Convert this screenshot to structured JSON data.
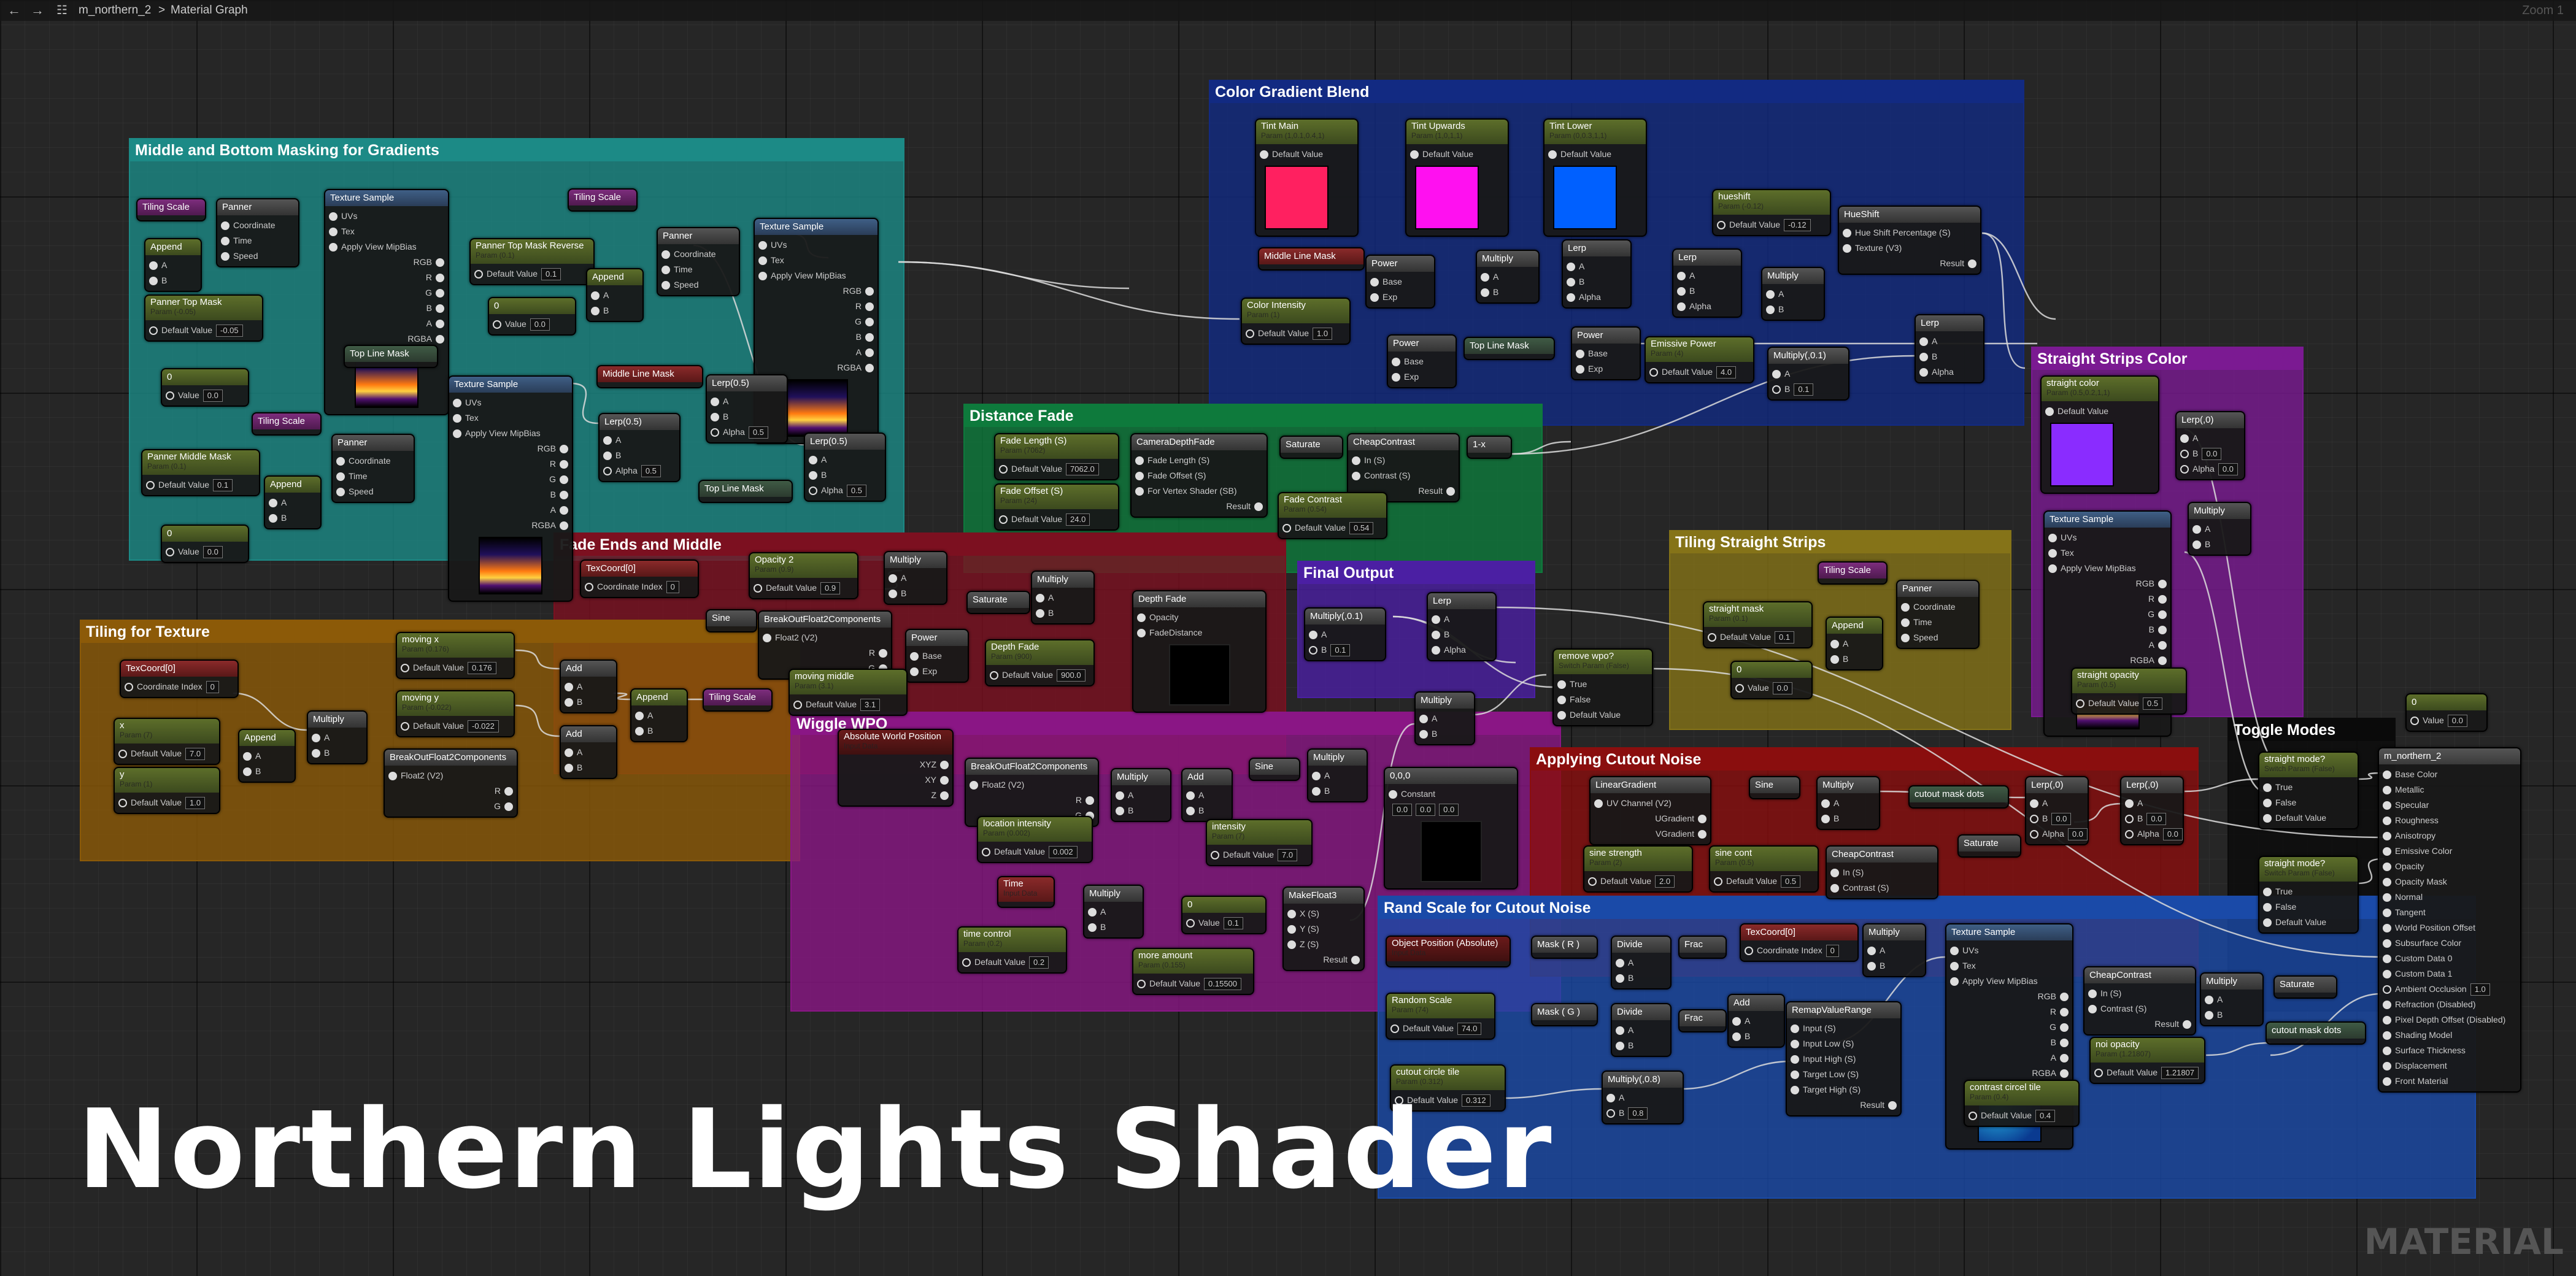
{
  "window": {
    "asset_name": "m_northern_2",
    "breadcrumb": "Material Graph",
    "zoom": "Zoom 1"
  },
  "icons": {
    "back": "arrow-left-icon",
    "forward": "arrow-right-icon",
    "graph": "graph-icon"
  },
  "title": "Northern Lights Shader",
  "watermark": "MATERIAL",
  "colors": {
    "teal": "#1c8a86",
    "blue": "#122a82",
    "green": "#0e7a3c",
    "crimson": "#7c1020",
    "orange": "#8c5a08",
    "purple": "#4b1fa3",
    "olive": "#857318",
    "magenta": "#8a1685",
    "violet": "#7b1a92",
    "red": "#8a0e0e",
    "rand_blue": "#1a4aa8",
    "black": "#0a0a0a",
    "swatch_red": "#ff2060",
    "swatch_magenta": "#ff10f0",
    "swatch_blue": "#0060ff",
    "swatch_violet": "#8a2cff"
  },
  "comments": [
    {
      "title": "Middle and Bottom Masking for Gradients"
    },
    {
      "title": "Color Gradient Blend"
    },
    {
      "title": "Distance Fade"
    },
    {
      "title": "Fade Ends and Middle"
    },
    {
      "title": "Tiling for Texture"
    },
    {
      "title": "Final Output"
    },
    {
      "title": "Tiling Straight Strips"
    },
    {
      "title": "Straight Strips Color"
    },
    {
      "title": "Wiggle WPO"
    },
    {
      "title": "Applying Cutout Noise"
    },
    {
      "title": "Toggle Modes"
    },
    {
      "title": "Rand Scale for Cutout Noise"
    }
  ],
  "nodes": {
    "tiling_scale_a": {
      "title": "Tiling Scale"
    },
    "panner_a": {
      "title": "Panner",
      "rows": [
        "Coordinate",
        "Time",
        "Speed"
      ]
    },
    "append_a": {
      "title": "Append",
      "rows": [
        "A",
        "B"
      ]
    },
    "panner_top_mask": {
      "title": "Panner Top Mask",
      "sub": "Param (-0.05)",
      "rows": [
        "Default Value"
      ],
      "val": "-0.05"
    },
    "texsample_a": {
      "title": "Texture Sample",
      "rows": [
        "UVs",
        "Tex",
        "Apply View MipBias"
      ],
      "outs": [
        "RGB",
        "R",
        "G",
        "B",
        "A",
        "RGBA"
      ]
    },
    "panner_top_mask_rev": {
      "title": "Panner Top Mask Reverse",
      "sub": "Param (0.1)",
      "rows": [
        "Default Value"
      ],
      "val": "0.1"
    },
    "append_b": {
      "title": "Append",
      "rows": [
        "A",
        "B"
      ]
    },
    "zero_a": {
      "title": "0",
      "rows": [
        "Value"
      ],
      "val": "0.0"
    },
    "tiling_scale_b": {
      "title": "Tiling Scale"
    },
    "panner_b": {
      "title": "Panner",
      "rows": [
        "Coordinate",
        "Time",
        "Speed"
      ]
    },
    "texsample_b": {
      "title": "Texture Sample",
      "rows": [
        "UVs",
        "Tex",
        "Apply View MipBias"
      ],
      "outs": [
        "RGB",
        "R",
        "G",
        "B",
        "A",
        "RGBA"
      ]
    },
    "top_line_mask_a": {
      "title": "Top Line Mask"
    },
    "zero_b": {
      "title": "0",
      "rows": [
        "Value"
      ],
      "val": "0.0"
    },
    "tiling_scale_c": {
      "title": "Tiling Scale"
    },
    "panner_c": {
      "title": "Panner",
      "rows": [
        "Coordinate",
        "Time",
        "Speed"
      ]
    },
    "panner_middle_mask": {
      "title": "Panner Middle Mask",
      "sub": "Param (0.1)",
      "rows": [
        "Default Value"
      ],
      "val": "0.1"
    },
    "append_c": {
      "title": "Append",
      "rows": [
        "A",
        "B"
      ]
    },
    "zero_c": {
      "title": "0",
      "rows": [
        "Value"
      ],
      "val": "0.0"
    },
    "texsample_c": {
      "title": "Texture Sample",
      "rows": [
        "UVs",
        "Tex",
        "Apply View MipBias"
      ],
      "outs": [
        "RGB",
        "R",
        "G",
        "B",
        "A",
        "RGBA"
      ]
    },
    "middle_line_mask_a": {
      "title": "Middle Line Mask"
    },
    "lerp_a": {
      "title": "Lerp(0.5)",
      "rows": [
        "A",
        "B",
        "Alpha"
      ],
      "val": "0.5"
    },
    "lerp_b": {
      "title": "Lerp(0.5)",
      "rows": [
        "A",
        "B",
        "Alpha"
      ],
      "val": "0.5"
    },
    "lerp_c": {
      "title": "Lerp(0.5)",
      "rows": [
        "A",
        "B",
        "Alpha"
      ],
      "val": "0.5"
    },
    "top_line_mask_b": {
      "title": "Top Line Mask"
    },
    "tint_main": {
      "title": "Tint Main",
      "sub": "Param (1,0.1,0.4,1)",
      "rows": [
        "Default Value"
      ]
    },
    "tint_upwards": {
      "title": "Tint Upwards",
      "sub": "Param (1,0,1,1)",
      "rows": [
        "Default Value"
      ]
    },
    "tint_lower": {
      "title": "Tint Lower",
      "sub": "Param (0,0.3,1,1)",
      "rows": [
        "Default Value"
      ]
    },
    "hueshift": {
      "title": "hueshift",
      "sub": "Param (-0.12)",
      "rows": [
        "Default Value"
      ],
      "val": "-0.12"
    },
    "hueshift_fn": {
      "title": "HueShift",
      "rows": [
        "Hue Shift Percentage (S)",
        "Texture (V3)"
      ],
      "outs": [
        "Result"
      ]
    },
    "middle_line_mask_b": {
      "title": "Middle Line Mask"
    },
    "power_a": {
      "title": "Power",
      "rows": [
        "Base",
        "Exp"
      ]
    },
    "color_intensity": {
      "title": "Color Intensity",
      "sub": "Param (1)",
      "rows": [
        "Default Value"
      ],
      "val": "1.0"
    },
    "multiply_a": {
      "title": "Multiply",
      "rows": [
        "A",
        "B"
      ]
    },
    "lerp_d": {
      "title": "Lerp",
      "rows": [
        "A",
        "B",
        "Alpha"
      ]
    },
    "lerp_e": {
      "title": "Lerp",
      "rows": [
        "A",
        "B",
        "Alpha"
      ]
    },
    "multiply_b": {
      "title": "Multiply",
      "rows": [
        "A",
        "B"
      ]
    },
    "power_b": {
      "title": "Power",
      "rows": [
        "Base",
        "Exp"
      ]
    },
    "top_line_mask_c": {
      "title": "Top Line Mask"
    },
    "power_c": {
      "title": "Power",
      "rows": [
        "Base",
        "Exp"
      ]
    },
    "emissive_power": {
      "title": "Emissive Power",
      "sub": "Param (4)",
      "rows": [
        "Default Value"
      ],
      "val": "4.0"
    },
    "multiply_c": {
      "title": "Multiply(,0.1)",
      "rows": [
        "A",
        "B"
      ],
      "val": "0.1"
    },
    "lerp_f": {
      "title": "Lerp",
      "rows": [
        "A",
        "B",
        "Alpha"
      ]
    },
    "fade_length": {
      "title": "Fade Length (S)",
      "sub": "Param (7062)",
      "rows": [
        "Default Value"
      ],
      "val": "7062.0"
    },
    "camera_depth_fade": {
      "title": "CameraDepthFade",
      "rows": [
        "Fade Length (S)",
        "Fade Offset (S)",
        "For Vertex Shader (SB)"
      ],
      "outs": [
        "Result"
      ]
    },
    "saturate_a": {
      "title": "Saturate"
    },
    "cheap_contrast_a": {
      "title": "CheapContrast",
      "rows": [
        "In (S)",
        "Contrast (S)"
      ],
      "outs": [
        "Result"
      ]
    },
    "one_minus_a": {
      "title": "1-x"
    },
    "fade_offset": {
      "title": "Fade Offset (S)",
      "sub": "Param (24)",
      "rows": [
        "Default Value"
      ],
      "val": "24.0"
    },
    "fade_contrast": {
      "title": "Fade Contrast",
      "sub": "Param (0.54)",
      "rows": [
        "Default Value"
      ],
      "val": "0.54"
    },
    "texcoord_a": {
      "title": "TexCoord[0]",
      "rows": [
        "Coordinate Index"
      ],
      "val": "0"
    },
    "opacity2": {
      "title": "Opacity 2",
      "sub": "Param (0.9)",
      "rows": [
        "Default Value"
      ],
      "val": "0.9"
    },
    "multiply_d": {
      "title": "Multiply",
      "rows": [
        "A",
        "B"
      ]
    },
    "sine_a": {
      "title": "Sine"
    },
    "breakout_a": {
      "title": "BreakOutFloat2Components",
      "rows": [
        "Float2 (V2)"
      ],
      "outs": [
        "R",
        "G"
      ]
    },
    "power_d": {
      "title": "Power",
      "rows": [
        "Base",
        "Exp"
      ]
    },
    "saturate_b": {
      "title": "Saturate"
    },
    "multiply_e": {
      "title": "Multiply",
      "rows": [
        "A",
        "B"
      ]
    },
    "depth_fade": {
      "title": "Depth Fade",
      "rows": [
        "Opacity",
        "FadeDistance"
      ]
    },
    "depth_fade_param": {
      "title": "Depth Fade",
      "sub": "Param (900)",
      "rows": [
        "Default Value"
      ],
      "val": "900.0"
    },
    "moving_middle": {
      "title": "moving middle",
      "sub": "Param (3.1)",
      "rows": [
        "Default Value"
      ],
      "val": "3.1"
    },
    "multiply_final": {
      "title": "Multiply(,0.1)",
      "rows": [
        "A",
        "B"
      ],
      "val": "0.1"
    },
    "lerp_final": {
      "title": "Lerp",
      "rows": [
        "A",
        "B",
        "Alpha"
      ]
    },
    "texcoord_b": {
      "title": "TexCoord[0]",
      "rows": [
        "Coordinate Index"
      ],
      "val": "0"
    },
    "moving_x": {
      "title": "moving x",
      "sub": "Param (0.176)",
      "rows": [
        "Default Value"
      ],
      "val": "0.176"
    },
    "moving_y": {
      "title": "moving y",
      "sub": "Param (-0.022)",
      "rows": [
        "Default Value"
      ],
      "val": "-0.022"
    },
    "x_param": {
      "title": "x",
      "sub": "Param (7)",
      "rows": [
        "Default Value"
      ],
      "val": "7.0"
    },
    "y_param": {
      "title": "y",
      "sub": "Param (1)",
      "rows": [
        "Default Value"
      ],
      "val": "1.0"
    },
    "append_d": {
      "title": "Append",
      "rows": [
        "A",
        "B"
      ]
    },
    "multiply_f": {
      "title": "Multiply",
      "rows": [
        "A",
        "B"
      ]
    },
    "breakout_b": {
      "title": "BreakOutFloat2Components",
      "rows": [
        "Float2 (V2)"
      ],
      "outs": [
        "R",
        "G"
      ]
    },
    "add_a": {
      "title": "Add",
      "rows": [
        "A",
        "B"
      ]
    },
    "add_b": {
      "title": "Add",
      "rows": [
        "A",
        "B"
      ]
    },
    "append_e": {
      "title": "Append",
      "rows": [
        "A",
        "B"
      ]
    },
    "tiling_scale_d": {
      "title": "Tiling Scale"
    },
    "abs_world_pos": {
      "title": "Absolute World Position",
      "sub": "Input Data",
      "outs": [
        "XYZ",
        "XY",
        "Z"
      ]
    },
    "breakout_c": {
      "title": "BreakOutFloat2Components",
      "rows": [
        "Float2 (V2)"
      ],
      "outs": [
        "R",
        "G"
      ]
    },
    "location_intensity": {
      "title": "location intensity",
      "sub": "Param (0.002)",
      "rows": [
        "Default Value"
      ],
      "val": "0.002"
    },
    "multiply_g": {
      "title": "Multiply",
      "rows": [
        "A",
        "B"
      ]
    },
    "add_c": {
      "title": "Add",
      "rows": [
        "A",
        "B"
      ]
    },
    "sine_b": {
      "title": "Sine"
    },
    "intensity": {
      "title": "intensity",
      "sub": "Param (7)",
      "rows": [
        "Default Value"
      ],
      "val": "7.0"
    },
    "multiply_h": {
      "title": "Multiply",
      "rows": [
        "A",
        "B"
      ]
    },
    "time_a": {
      "title": "Time",
      "sub": "Input Data"
    },
    "multiply_i": {
      "title": "Multiply",
      "rows": [
        "A",
        "B"
      ]
    },
    "time_control": {
      "title": "time control",
      "sub": "Param (0.2)",
      "rows": [
        "Default Value"
      ],
      "val": "0.2"
    },
    "zero_d": {
      "title": "0",
      "rows": [
        "Value"
      ],
      "val": "0.1"
    },
    "make_float3": {
      "title": "MakeFloat3",
      "rows": [
        "X (S)",
        "Y (S)",
        "Z (S)"
      ],
      "outs": [
        "Result"
      ]
    },
    "more_amount": {
      "title": "more amount",
      "sub": "Param (0.155)",
      "rows": [
        "Default Value"
      ],
      "val": "0.15500"
    },
    "wpo_multiply": {
      "title": "Multiply",
      "rows": [
        "A",
        "B"
      ]
    },
    "constant3": {
      "title": "0,0,0",
      "rows": [
        "Constant"
      ],
      "vals": [
        "0.0",
        "0.0",
        "0.0"
      ]
    },
    "remove_wpo": {
      "title": "remove wpo?",
      "sub": "Switch Param (False)",
      "rows": [
        "True",
        "False",
        "Default Value"
      ]
    },
    "linear_gradient": {
      "title": "LinearGradient",
      "rows": [
        "UV Channel (V2)"
      ],
      "outs": [
        "UGradient",
        "VGradient"
      ]
    },
    "sine_c": {
      "title": "Sine"
    },
    "multiply_j": {
      "title": "Multiply",
      "rows": [
        "A",
        "B"
      ]
    },
    "cutout_mask_dots_a": {
      "title": "cutout mask dots"
    },
    "lerp_g": {
      "title": "Lerp(,0)",
      "rows": [
        "A",
        "B",
        "Alpha"
      ],
      "val": "0.0"
    },
    "lerp_h": {
      "title": "Lerp(,0)",
      "rows": [
        "A",
        "B",
        "Alpha"
      ],
      "val": "0.0"
    },
    "sine_strength": {
      "title": "sine strength",
      "sub": "Param (2)",
      "rows": [
        "Default Value"
      ],
      "val": "2.0"
    },
    "sine_cont": {
      "title": "sine cont",
      "sub": "Param (0.5)",
      "rows": [
        "Default Value"
      ],
      "val": "0.5"
    },
    "cheap_contrast_b": {
      "title": "CheapContrast",
      "rows": [
        "In (S)",
        "Contrast (S)"
      ]
    },
    "saturate_c": {
      "title": "Saturate"
    },
    "straight_mask": {
      "title": "straight mask",
      "sub": "Param (0.1)",
      "rows": [
        "Default Value"
      ],
      "val": "0.1"
    },
    "tiling_scale_e": {
      "title": "Tiling Scale"
    },
    "append_f": {
      "title": "Append",
      "rows": [
        "A",
        "B"
      ]
    },
    "panner_d": {
      "title": "Panner",
      "rows": [
        "Coordinate",
        "Time",
        "Speed"
      ]
    },
    "zero_e": {
      "title": "0",
      "rows": [
        "Value"
      ],
      "val": "0.0"
    },
    "straight_strips_color": {
      "title": "straight color",
      "sub": "Param (0.5,0.2,1,1)",
      "rows": [
        "Default Value"
      ]
    },
    "lerp_i": {
      "title": "Lerp(,0)",
      "rows": [
        "A",
        "B",
        "Alpha"
      ],
      "val": "0.0"
    },
    "multiply_k": {
      "title": "Multiply",
      "rows": [
        "A",
        "B"
      ]
    },
    "texsample_d": {
      "title": "Texture Sample",
      "rows": [
        "UVs",
        "Tex",
        "Apply View MipBias"
      ],
      "outs": [
        "RGB",
        "R",
        "G",
        "B",
        "A",
        "RGBA"
      ]
    },
    "straight_opacity": {
      "title": "straight opacity",
      "sub": "Param (0.5)",
      "rows": [
        "Default Value"
      ],
      "val": "0.5"
    },
    "zero_f": {
      "title": "0",
      "rows": [
        "Value"
      ],
      "val": "0.0"
    },
    "straight_mode_a": {
      "title": "straight mode?",
      "sub": "Switch Param (False)",
      "rows": [
        "True",
        "False",
        "Default Value"
      ]
    },
    "straight_mode_b": {
      "title": "straight mode?",
      "sub": "Switch Param (False)",
      "rows": [
        "True",
        "False",
        "Default Value"
      ]
    },
    "object_position": {
      "title": "Object Position (Absolute)",
      "sub": "Input Data"
    },
    "mask_rg_a": {
      "title": "Mask ( R )"
    },
    "divide_a": {
      "title": "Divide",
      "rows": [
        "A",
        "B"
      ]
    },
    "frac_a": {
      "title": "Frac"
    },
    "random_scale": {
      "title": "Random Scale",
      "sub": "Param (74)",
      "rows": [
        "Default Value"
      ],
      "val": "74.0"
    },
    "mask_g": {
      "title": "Mask ( G )"
    },
    "divide_b": {
      "title": "Divide",
      "rows": [
        "A",
        "B"
      ]
    },
    "frac_b": {
      "title": "Frac"
    },
    "add_d": {
      "title": "Add",
      "rows": [
        "A",
        "B"
      ]
    },
    "texcoord_c": {
      "title": "TexCoord[0]",
      "rows": [
        "Coordinate Index"
      ],
      "val": "0"
    },
    "multiply_l": {
      "title": "Multiply",
      "rows": [
        "A",
        "B"
      ]
    },
    "remap": {
      "title": "RemapValueRange",
      "rows": [
        "Input (S)",
        "Input Low (S)",
        "Input High (S)",
        "Target Low (S)",
        "Target High (S)"
      ],
      "outs": [
        "Result"
      ]
    },
    "texsample_e": {
      "title": "Texture Sample",
      "rows": [
        "UVs",
        "Tex",
        "Apply View MipBias"
      ],
      "outs": [
        "RGB",
        "R",
        "G",
        "B",
        "A",
        "RGBA"
      ]
    },
    "cheap_contrast_c": {
      "title": "CheapContrast",
      "rows": [
        "In (S)",
        "Contrast (S)"
      ],
      "outs": [
        "Result"
      ]
    },
    "multiply_m": {
      "title": "Multiply",
      "rows": [
        "A",
        "B"
      ]
    },
    "saturate_d": {
      "title": "Saturate"
    },
    "cutout_mask_dots_b": {
      "title": "cutout mask dots"
    },
    "noise_opacity": {
      "title": "noi opacity",
      "sub": "Param (1.21807)",
      "rows": [
        "Default Value"
      ],
      "val": "1.21807"
    },
    "cutout_circle_tile_a": {
      "title": "cutout circle tile",
      "sub": "Param (0.312)",
      "rows": [
        "Default Value"
      ],
      "val": "0.312"
    },
    "multiply_n": {
      "title": "Multiply(,0.8)",
      "rows": [
        "A",
        "B"
      ],
      "val": "0.8"
    },
    "contrast_circel_tile": {
      "title": "contrast circel tile",
      "sub": "Param (0.4)",
      "rows": [
        "Default Value"
      ],
      "val": "0.4"
    },
    "zero_g": {
      "title": "0",
      "rows": [
        "Value"
      ],
      "val": "0.0"
    },
    "m_northern_2": {
      "title": "m_northern_2",
      "pins": [
        "Base Color",
        "Metallic",
        "Specular",
        "Roughness",
        "Anisotropy",
        "Emissive Color",
        "Opacity",
        "Opacity Mask",
        "Normal",
        "Tangent",
        "World Position Offset",
        "Subsurface Color",
        "Custom Data 0",
        "Custom Data 1",
        "Ambient Occlusion",
        "Refraction (Disabled)",
        "Pixel Depth Offset (Disabled)",
        "Shading Model",
        "Surface Thickness",
        "Displacement",
        "Front Material"
      ],
      "ao_val": "1.0"
    }
  }
}
